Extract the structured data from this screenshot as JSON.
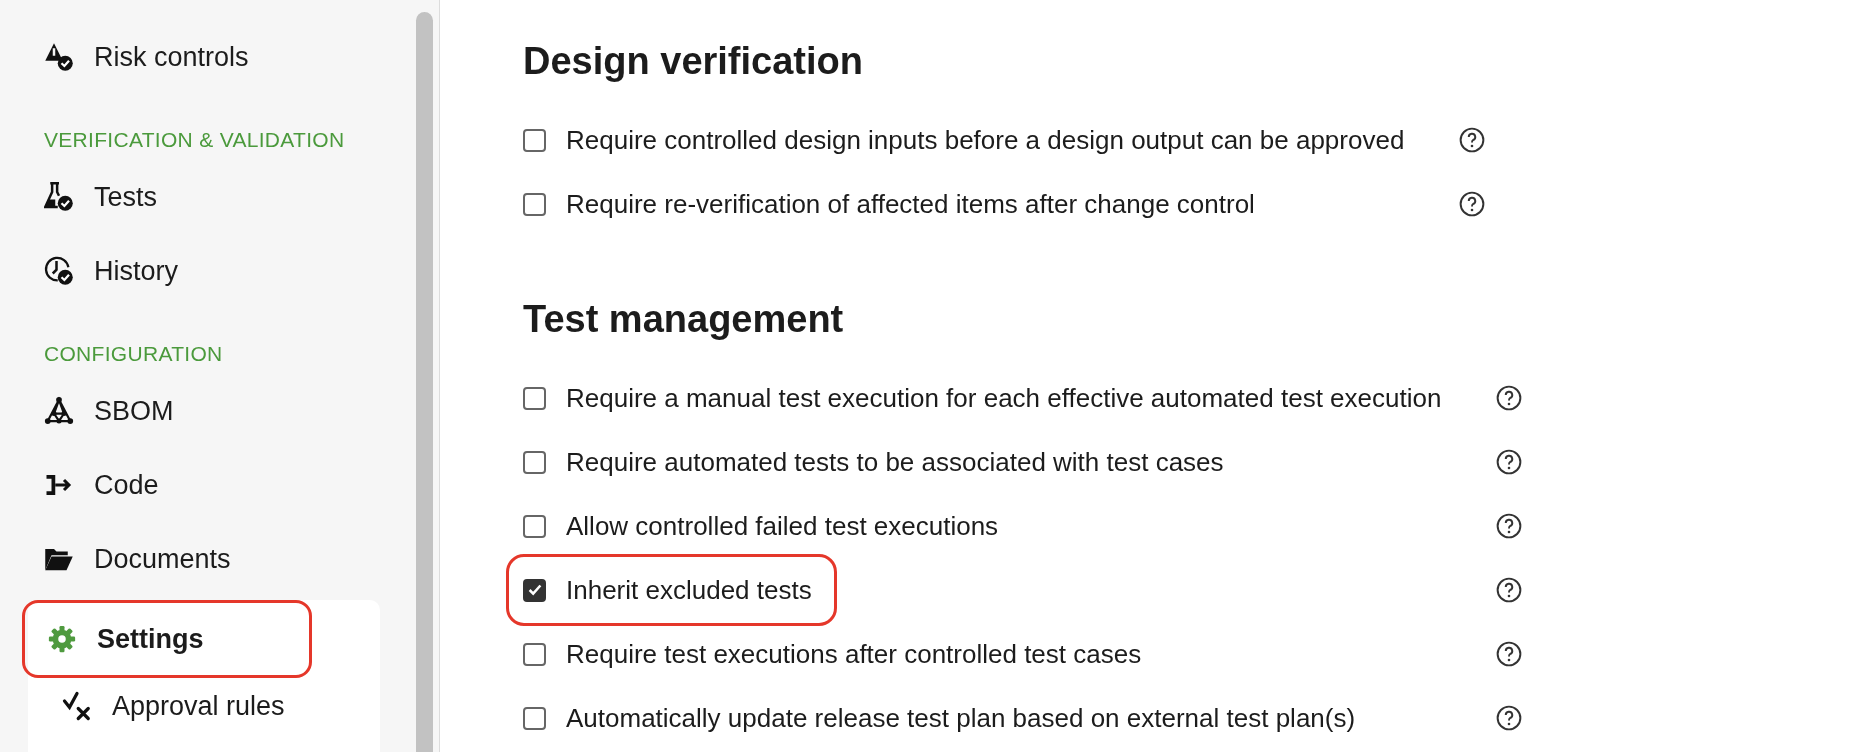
{
  "sidebar": {
    "items": [
      {
        "kind": "item",
        "label": "Risk controls",
        "selected": false,
        "highlighted": false
      },
      {
        "kind": "section",
        "label": "VERIFICATION & VALIDATION"
      },
      {
        "kind": "item",
        "label": "Tests",
        "selected": false,
        "highlighted": false
      },
      {
        "kind": "item",
        "label": "History",
        "selected": false,
        "highlighted": false
      },
      {
        "kind": "section",
        "label": "CONFIGURATION"
      },
      {
        "kind": "item",
        "label": "SBOM",
        "selected": false,
        "highlighted": false
      },
      {
        "kind": "item",
        "label": "Code",
        "selected": false,
        "highlighted": false
      },
      {
        "kind": "item",
        "label": "Documents",
        "selected": false,
        "highlighted": false
      },
      {
        "kind": "item",
        "label": "Settings",
        "selected": true,
        "highlighted": true,
        "children": [
          {
            "label": "Approval rules",
            "selected": false
          }
        ]
      }
    ]
  },
  "sections": [
    {
      "title": "Design verification",
      "options": [
        {
          "label": "Require controlled design inputs before a design output can be approved",
          "checked": false,
          "highlighted": false
        },
        {
          "label": "Require re-verification of affected items after change control",
          "checked": false,
          "highlighted": false
        }
      ]
    },
    {
      "title": "Test management",
      "options": [
        {
          "label": "Require a manual test execution for each effective automated test execution",
          "checked": false,
          "highlighted": false
        },
        {
          "label": "Require automated tests to be associated with test cases",
          "checked": false,
          "highlighted": false
        },
        {
          "label": "Allow controlled failed test executions",
          "checked": false,
          "highlighted": false
        },
        {
          "label": "Inherit excluded tests",
          "checked": true,
          "highlighted": true
        },
        {
          "label": "Require test executions after controlled test cases",
          "checked": false,
          "highlighted": false
        },
        {
          "label": "Automatically update release test plan based on external test plan(s)",
          "checked": false,
          "highlighted": false
        }
      ]
    }
  ]
}
